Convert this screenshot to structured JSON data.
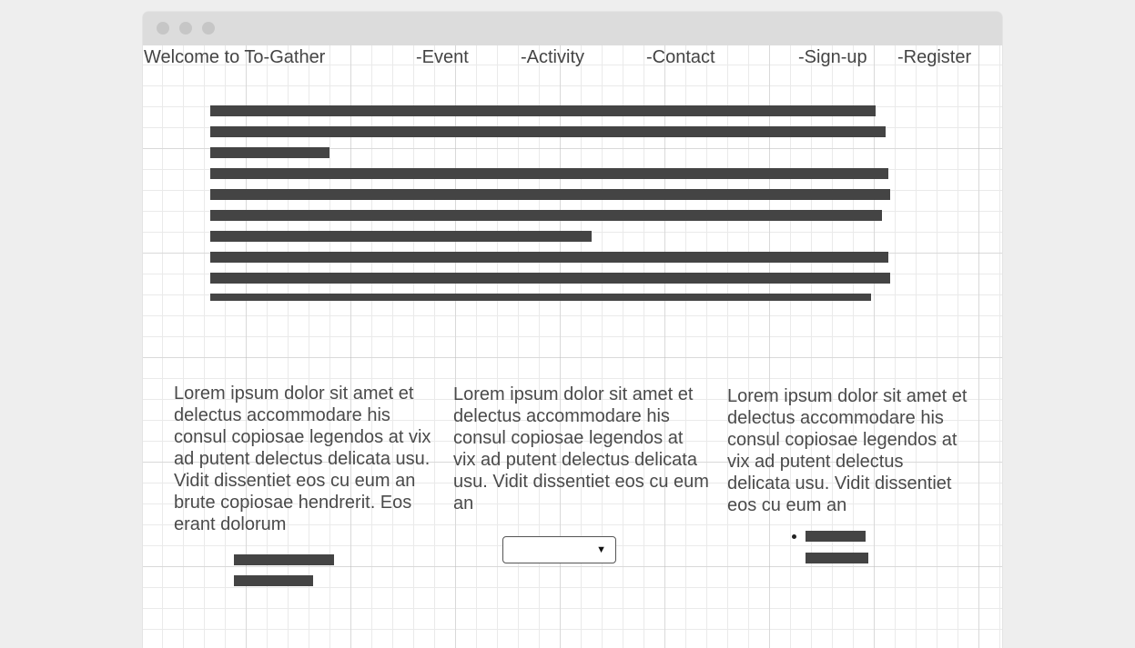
{
  "header": {
    "brand": "Welcome to To-Gather",
    "nav": [
      "-Event",
      "-Activity",
      "-Contact",
      "-Sign-up",
      "-Register"
    ]
  },
  "columns": [
    {
      "text": "Lorem ipsum dolor sit amet et delectus accommodare his consul copiosae legendos at vix ad putent delectus delicata usu. Vidit dissentiet eos cu eum an brute copiosae hendrerit. Eos erant dolorum"
    },
    {
      "text": "Lorem ipsum dolor sit amet et delectus accommodare his consul copiosae legendos at vix ad putent delectus delicata usu. Vidit dissentiet eos cu eum an"
    },
    {
      "text": "Lorem ipsum dolor sit amet et delectus accommodare his consul copiosae legendos at vix ad putent delectus delicata usu. Vidit dissentiet eos cu eum an"
    }
  ],
  "dropdown": {
    "value": "",
    "caret": "▼"
  },
  "colors": {
    "placeholder_bar": "#444444",
    "text": "#444444",
    "titlebar": "#dcdcdc"
  }
}
